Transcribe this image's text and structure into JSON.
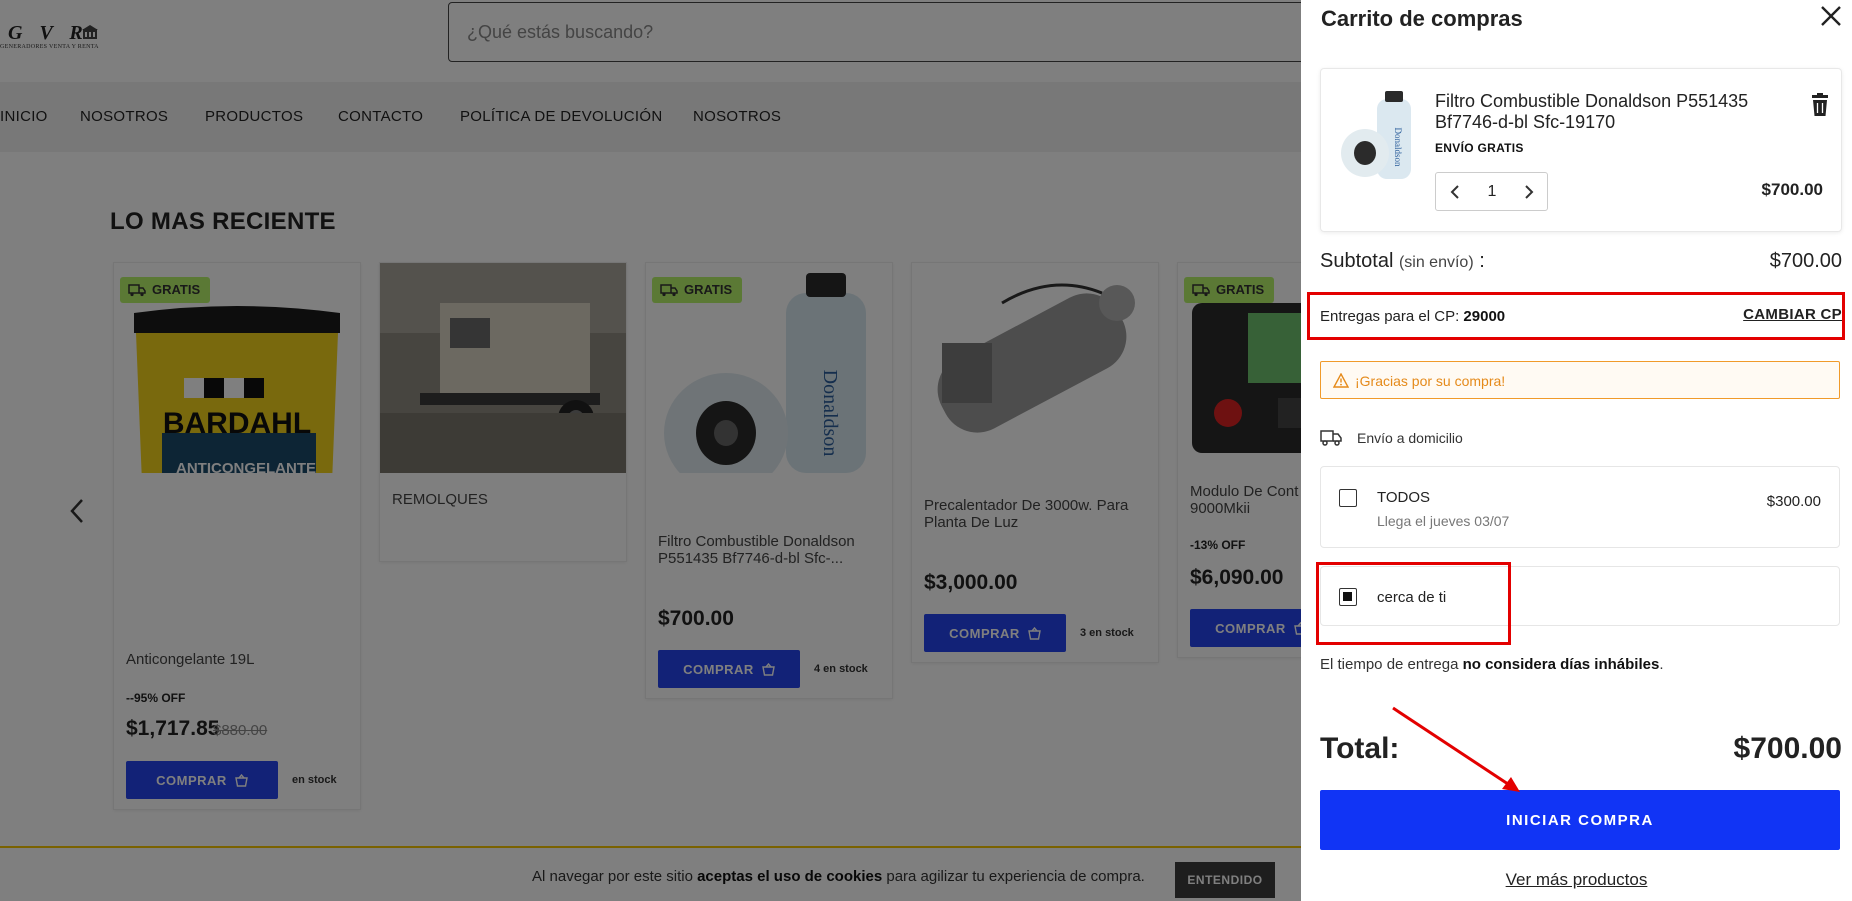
{
  "logo": {
    "main": "G V R",
    "sub": "GENERADORES VENTA Y RENTA"
  },
  "search": {
    "placeholder": "¿Qué estás buscando?"
  },
  "nav": {
    "items": [
      {
        "label": "INICIO"
      },
      {
        "label": "NOSOTROS"
      },
      {
        "label": "PRODUCTOS"
      },
      {
        "label": "CONTACTO"
      },
      {
        "label": "POLÍTICA DE DEVOLUCIÓN"
      },
      {
        "label": "NOSOTROS"
      }
    ]
  },
  "section": {
    "title": "LO MAS RECIENTE"
  },
  "products": [
    {
      "badge": "GRATIS",
      "name": "Anticongelante 19L",
      "discount": "--95% OFF",
      "price": "$1,717.85",
      "old_price": "$880.00",
      "buy": "COMPRAR",
      "stock": "en stock",
      "img_text": "BARDAHL",
      "img_text2": "ANTICONGELANTE"
    },
    {
      "badge": "",
      "name": "REMOLQUES",
      "discount": "",
      "price": "",
      "old_price": "",
      "buy": "",
      "stock": ""
    },
    {
      "badge": "GRATIS",
      "name": "Filtro Combustible Donaldson P551435 Bf7746-d-bl Sfc-...",
      "discount": "",
      "price": "$700.00",
      "old_price": "",
      "buy": "COMPRAR",
      "stock": "4 en stock"
    },
    {
      "badge": "",
      "name": "Precalentador De 3000w. Para Planta De Luz",
      "discount": "",
      "price": "$3,000.00",
      "old_price": "",
      "buy": "COMPRAR",
      "stock": "3 en stock"
    },
    {
      "badge": "GRATIS",
      "name": "Modulo De Cont 9000Mkii",
      "discount": "-13% OFF",
      "price": "$6,090.00",
      "old_price": "",
      "buy": "COMPRAR",
      "stock": ""
    }
  ],
  "cookie": {
    "pre": "Al navegar por este sitio ",
    "bold": "aceptas el uso de cookies",
    "post": " para agilizar tu experiencia de compra.",
    "button": "ENTENDIDO"
  },
  "cart": {
    "title": "Carrito de compras",
    "item": {
      "name": "Filtro Combustible Donaldson P551435 Bf7746-d-bl Sfc-19170",
      "shipping": "ENVÍO GRATIS",
      "qty": "1",
      "price": "$700.00"
    },
    "subtotal": {
      "label": "Subtotal",
      "note": "(sin envío)",
      "colon": " :",
      "value": "$700.00"
    },
    "cp": {
      "label": "Entregas para el CP: ",
      "value": "29000",
      "change": "CAMBIAR CP"
    },
    "alert": "¡Gracias por su compra!",
    "shipping_method": "Envío a domicilio",
    "options": [
      {
        "name": "TODOS",
        "sub": "Llega el jueves 03/07",
        "price": "$300.00",
        "checked": false
      },
      {
        "name": "cerca de ti",
        "sub": "",
        "price": "",
        "checked": true
      }
    ],
    "note": {
      "pre": "El tiempo de entrega ",
      "bold": "no considera días inhábiles",
      "post": "."
    },
    "total": {
      "label": "Total:",
      "value": "$700.00"
    },
    "start_button": "INICIAR COMPRA",
    "more_link": "Ver más productos"
  },
  "colors": {
    "accent_blue": "#1134f5",
    "buy_blue": "#2445ee",
    "badge_green": "#b7f36b",
    "alert_orange": "#f09a2a",
    "annotation_red": "#e30000"
  }
}
